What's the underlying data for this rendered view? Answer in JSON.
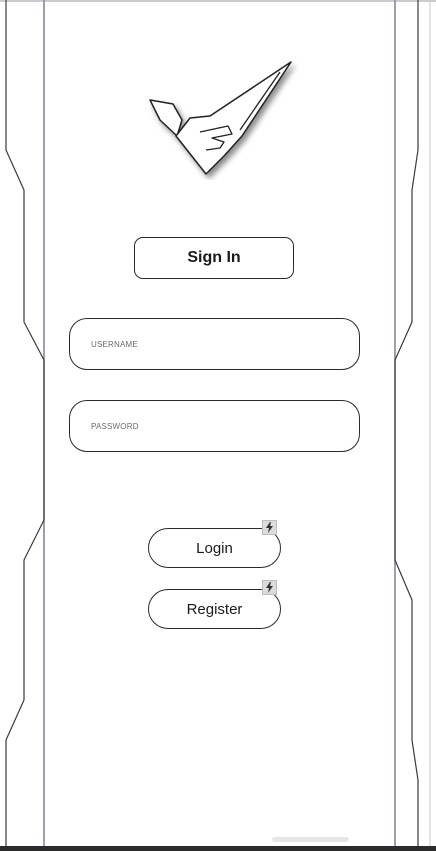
{
  "header": {
    "title": "Sign In"
  },
  "form": {
    "username": {
      "placeholder": "USERNAME",
      "value": ""
    },
    "password": {
      "placeholder": "PASSWORD",
      "value": ""
    }
  },
  "actions": {
    "login_label": "Login",
    "register_label": "Register"
  },
  "icons": {
    "logo": "ve-logo",
    "login_badge": "bolt-icon",
    "register_badge": "bolt-icon"
  }
}
